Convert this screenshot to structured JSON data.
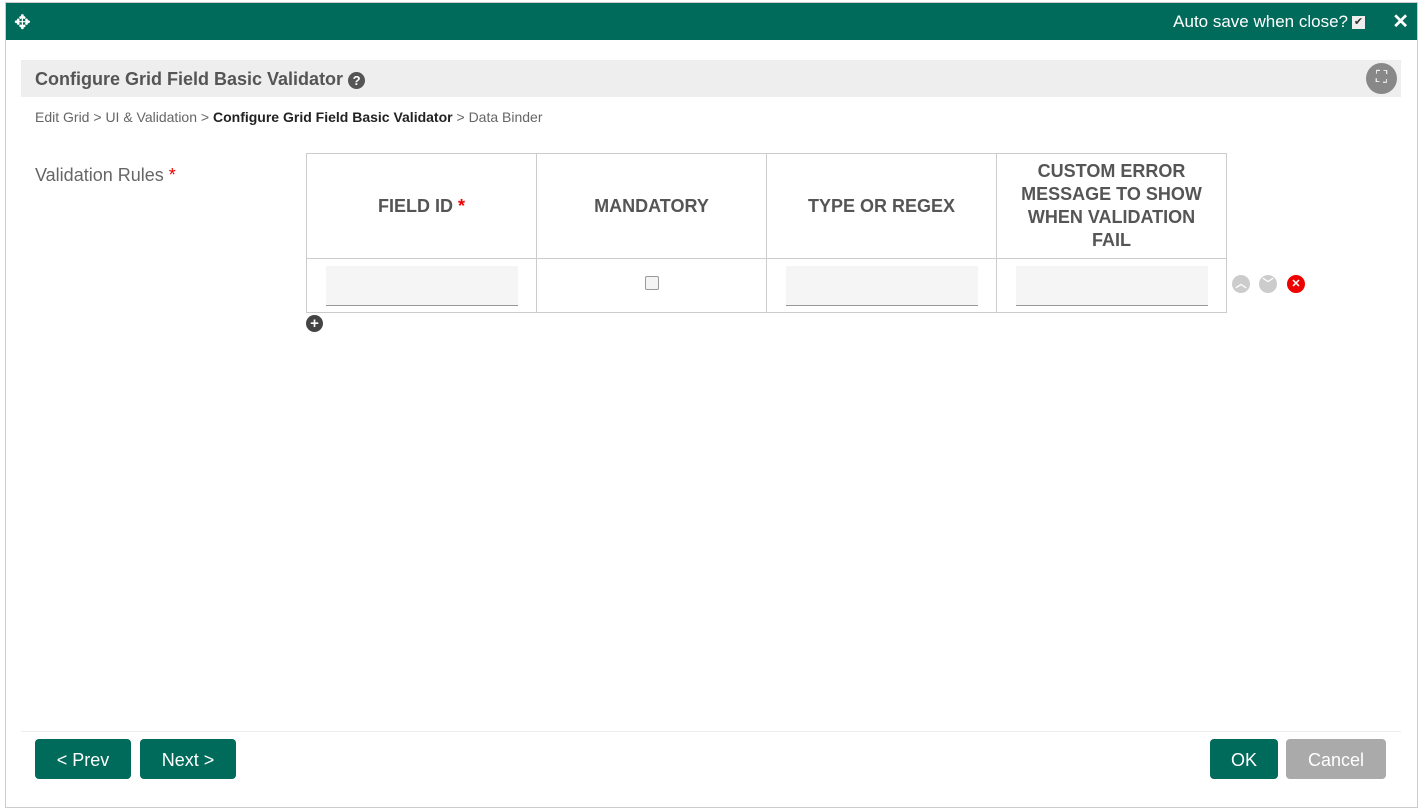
{
  "topbar": {
    "autosave_label": "Auto save when close?",
    "autosave_checked": true
  },
  "title": "Configure Grid Field Basic Validator",
  "breadcrumb": [
    "Edit Grid",
    "UI & Validation",
    "Configure Grid Field Basic Validator",
    "Data Binder"
  ],
  "separator": ">",
  "field_label": "Validation Rules",
  "required_mark": "*",
  "columns": [
    "FIELD ID",
    "MANDATORY",
    "TYPE OR REGEX",
    "CUSTOM ERROR MESSAGE TO SHOW WHEN VALIDATION FAIL"
  ],
  "row": {
    "field_id": "",
    "mandatory": false,
    "type": "",
    "message": ""
  },
  "buttons": {
    "prev": "< Prev",
    "next": "Next >",
    "ok": "OK",
    "cancel": "Cancel"
  }
}
